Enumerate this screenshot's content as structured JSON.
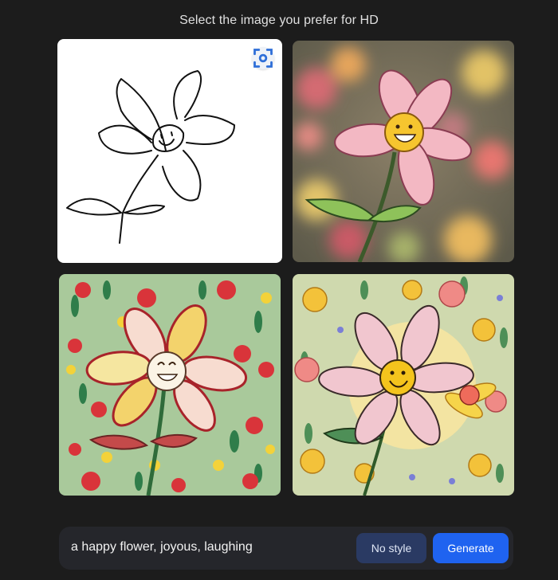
{
  "header": {
    "title": "Select the image you prefer for HD"
  },
  "images": [
    {
      "style": "sketch",
      "description_icon": "expand-icon"
    },
    {
      "style": "painted-bokeh"
    },
    {
      "style": "red-yellow-field"
    },
    {
      "style": "pink-smiley-field"
    }
  ],
  "prompt": {
    "text": "a happy flower, joyous, laughing",
    "style_button": "No style",
    "generate_button": "Generate"
  },
  "colors": {
    "background": "#1c1c1c",
    "prompt_bar": "#25262b",
    "generate_button": "#1f63f0",
    "style_button": "#2a3a63"
  }
}
